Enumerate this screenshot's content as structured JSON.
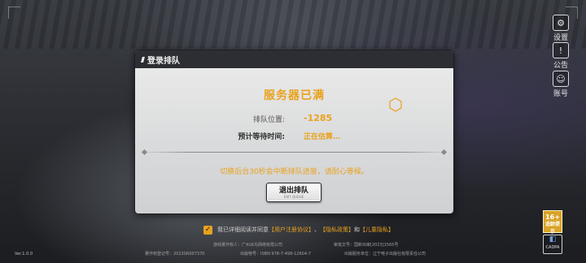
{
  "side_menu": [
    {
      "label": "设置",
      "icon": "gear-icon"
    },
    {
      "label": "公告",
      "icon": "notice-icon"
    },
    {
      "label": "账号",
      "icon": "account-icon"
    }
  ],
  "dialog": {
    "header": "登录排队",
    "title": "服务器已满",
    "queue_position_label": "排队位置:",
    "queue_position_value": "-1285",
    "wait_time_label": "预计等待时间:",
    "wait_time_value": "正在估算…",
    "hint": "切换后台30秒会中断排队进度，请耐心等候。",
    "exit_button": "退出排队",
    "exit_button_sub": "EXIT QUEUE"
  },
  "agreement": {
    "checked": true,
    "text_before": "我已详细阅读并同意",
    "link1": "【用户注册协议】",
    "sep1": "、",
    "link2": "【隐私政策】",
    "sep2": "和",
    "link3": "【儿童隐私】"
  },
  "legal": {
    "line1_left": "游戏著作权人：广州冰鸟网络有限公司",
    "line1_right": "审批文号：国新出审[2023]1565号",
    "line2_a": "著作权登记号：2023SR007370",
    "line2_b": "出版物号：ISBN 978-7-498-12604-7",
    "line2_c": "出版服务单位：辽宁电子出版社有限责任公司"
  },
  "version": "Ver.1.0.0",
  "age_badge": {
    "top": "16+",
    "bottom": "适龄提示"
  },
  "cadpa": {
    "glyph": "◧",
    "text": "CADPA"
  },
  "colors": {
    "accent": "#e9a21c",
    "dialog_header": "#2c2e34"
  }
}
